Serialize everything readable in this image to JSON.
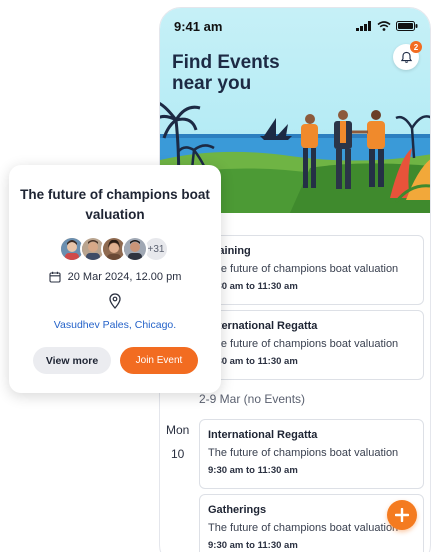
{
  "status_bar": {
    "time": "9:41 am"
  },
  "header": {
    "title": "Find Events near you",
    "notification_count": "2"
  },
  "events_top": [
    {
      "title": "Training",
      "description": "The future of champions boat valuation",
      "time": "9:30 am to 11:30 am"
    },
    {
      "title": "International Regatta",
      "description": "The future of champions boat valuation",
      "time": "9:30 am to 11:30 am"
    }
  ],
  "week_label": "2-9 Mar (no Events)",
  "day": {
    "name": "Mon",
    "number": "10"
  },
  "events_day": [
    {
      "title": "International Regatta",
      "description": "The future of champions boat valuation",
      "time": "9:30 am to 11:30 am"
    },
    {
      "title": "Gatherings",
      "description": "The future of champions boat valuation",
      "time": "9:30 am to 11:30 am"
    }
  ],
  "popup": {
    "title": "The future of champions boat valuation",
    "attendees_more": "+31",
    "date": "20 Mar 2024, 12.00 pm",
    "location": "Vasudhev Pales, Chicago.",
    "view_more_label": "View more",
    "join_label": "Join Event"
  },
  "colors": {
    "accent": "#f26c21",
    "link": "#2563c9",
    "hero_sky": "#c6f0f7"
  },
  "icons": [
    "signal-icon",
    "wifi-icon",
    "battery-icon",
    "bell-icon",
    "calendar-icon",
    "location-pin-icon",
    "plus-icon"
  ]
}
